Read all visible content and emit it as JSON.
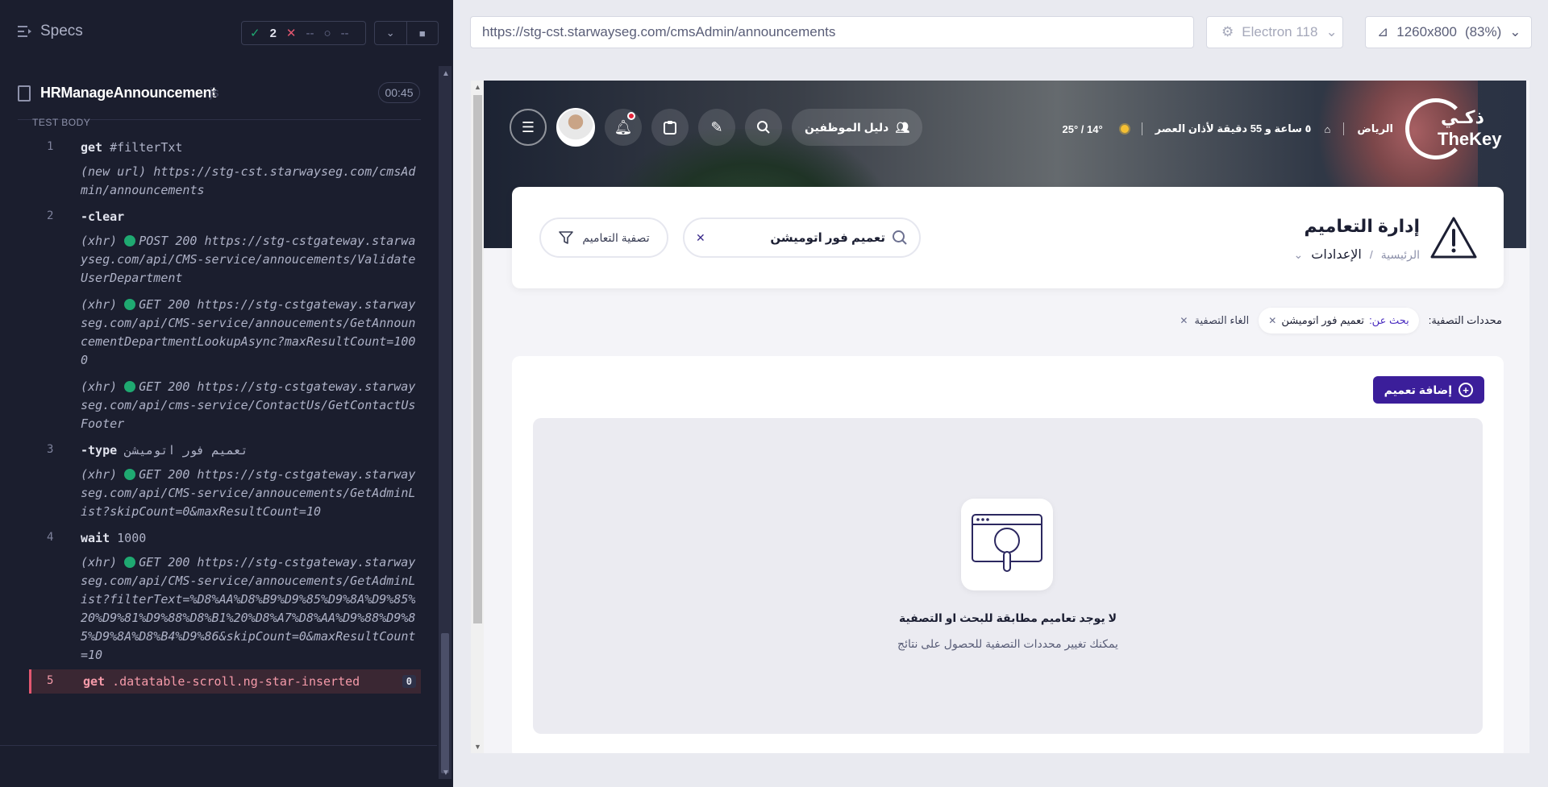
{
  "runner": {
    "specs_label": "Specs",
    "stats": {
      "passed": "2",
      "failed": "--",
      "pending": "--"
    },
    "test_title": "HRManageAnnouncement",
    "test_title_suffix": "js",
    "duration": "00:45",
    "section_label": "TEST BODY",
    "commands": [
      {
        "index": "1",
        "name": "get",
        "arg": "#filterTxt"
      },
      {
        "text": "(new url)  https://stg-cst.starwayseg.com/cmsAdmin/announcements"
      },
      {
        "index": "2",
        "name": "-clear",
        "arg": ""
      },
      {
        "prefix": "(xhr)",
        "text": "POST 200 https://stg-cstgateway.starwayseg.com/api/CMS-service/annoucements/ValidateUserDepartment"
      },
      {
        "prefix": "(xhr)",
        "text": "GET 200 https://stg-cstgateway.starwayseg.com/api/CMS-service/annoucements/GetAnnouncementDepartmentLookupAsync?maxResultCount=1000"
      },
      {
        "prefix": "(xhr)",
        "text": "GET 200 https://stg-cstgateway.starwayseg.com/api/cms-service/ContactUs/GetContactUsFooter"
      },
      {
        "index": "3",
        "name": "-type",
        "arg": "تعميم فور اتوميشن"
      },
      {
        "prefix": "(xhr)",
        "text": "GET 200 https://stg-cstgateway.starwayseg.com/api/CMS-service/annoucements/GetAdminList?skipCount=0&maxResultCount=10"
      },
      {
        "index": "4",
        "name": "wait",
        "arg": "1000"
      },
      {
        "prefix": "(xhr)",
        "text": "GET 200 https://stg-cstgateway.starwayseg.com/api/CMS-service/annoucements/GetAdminList?filterText=%D8%AA%D8%B9%D9%85%D9%8A%D9%85%20%D9%81%D9%88%D8%B1%20%D8%A7%D8%AA%D9%88%D9%85%D9%8A%D8%B4%D9%86&skipCount=0&maxResultCount=10"
      },
      {
        "index": "5",
        "name": "get",
        "arg": ".datatable-scroll.ng-star-inserted",
        "badge": "0"
      }
    ]
  },
  "browser": {
    "url": "https://stg-cst.starwayseg.com/cmsAdmin/announcements",
    "engine": "Electron 118",
    "viewport": "1260x800",
    "zoom": "(83%)"
  },
  "app": {
    "logo_ar": "ذكـي",
    "logo_en": "TheKey",
    "city": "الرياض",
    "prayer": "٥ ساعة و 55 دقيقة لأذان العصر",
    "weather": "25° / 14°",
    "employee_guide": "دليل الموظفين",
    "page_title": "إدارة التعاميم",
    "breadcrumb_home": "الرئيسية",
    "breadcrumb_current": "الإعدادات",
    "search_value": "تعميم فور اتوميشن",
    "filter_button": "تصفية التعاميم",
    "filters_label": "محددات التصفية:",
    "chip_key": "بحث عن:",
    "chip_value": "تعميم فور اتوميشن",
    "clear_filters": "الغاء التصفية",
    "add_button": "إضافة تعميم",
    "empty_title": "لا يوجد تعاميم مطابقة للبحث او التصفية",
    "empty_subtitle": "يمكنك تغيير محددات التصفية للحصول على نتائج"
  }
}
